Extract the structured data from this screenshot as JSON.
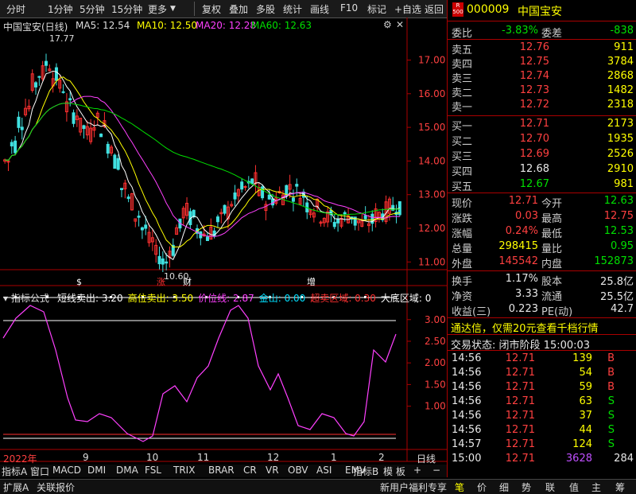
{
  "toolbar": {
    "left_items": [
      "分时",
      "1分钟",
      "5分钟",
      "15分钟",
      "更多"
    ],
    "right_items": [
      "复权",
      "叠加",
      "多股",
      "统计",
      "画线",
      "F10",
      "标记",
      "+自选",
      "返回"
    ]
  },
  "chart": {
    "title": "中国宝安(日线)",
    "ma5_label": "MA5: 12.54",
    "ma10_label": "MA10: 12.50",
    "ma20_label": "MA20: 12.28",
    "ma60_label": "MA60: 12.63",
    "high_label": "17.77",
    "low_label": "10.60",
    "price_ticks": [
      "17.00",
      "16.00",
      "15.00",
      "14.00",
      "13.00",
      "12.00",
      "11.00"
    ],
    "event_marks": [
      "$",
      "涨",
      "财",
      "增"
    ],
    "indicator_line": "指标公式",
    "ind_labels": [
      {
        "name": "短线卖出:",
        "value": "3.20",
        "color": "#ffffff"
      },
      {
        "name": "高位卖出:",
        "value": "3.50",
        "color": "#ffff00"
      },
      {
        "name": "价位线:",
        "value": "2.87",
        "color": "#ff40ff"
      },
      {
        "name": "金山:",
        "value": "0.00",
        "color": "#00e0ff"
      },
      {
        "name": "超卖区域:",
        "value": "0.30",
        "color": "#ff3030"
      },
      {
        "name": "大底区域:",
        "value": "0",
        "color": "#ffffff"
      }
    ],
    "ind_ticks": [
      "3.00",
      "2.50",
      "2.00",
      "1.50",
      "1.00"
    ],
    "date_labels": [
      "2022年",
      "9",
      "10",
      "11",
      "12",
      "1",
      "2"
    ],
    "period_label": "日线"
  },
  "indicator_tabs": [
    "指标A",
    "窗口",
    "MACD",
    "DMI",
    "DMA",
    "FSL",
    "TRIX",
    "BRAR",
    "CR",
    "VR",
    "OBV",
    "ASI",
    "EMV"
  ],
  "indicator_right": [
    "指标B",
    "模 板",
    "+",
    "−"
  ],
  "bottom_tabs_left": [
    "扩展A",
    "关联报价"
  ],
  "bottom_tabs_right": [
    "新用户福利专享",
    "笔",
    "价",
    "细",
    "势",
    "联",
    "值",
    "主",
    "筹"
  ],
  "quote": {
    "code": "000009",
    "name": "中国宝安",
    "r_badge": "R\n500",
    "weibi_label": "委比",
    "weibi": "-3.83%",
    "weicha_label": "委差",
    "weicha": "-838",
    "asks": [
      {
        "label": "卖五",
        "price": "12.76",
        "vol": "911"
      },
      {
        "label": "卖四",
        "price": "12.75",
        "vol": "3784"
      },
      {
        "label": "卖三",
        "price": "12.74",
        "vol": "2868"
      },
      {
        "label": "卖二",
        "price": "12.73",
        "vol": "1482"
      },
      {
        "label": "卖一",
        "price": "12.72",
        "vol": "2318"
      }
    ],
    "bids": [
      {
        "label": "买一",
        "price": "12.71",
        "vol": "2173",
        "color": "red"
      },
      {
        "label": "买二",
        "price": "12.70",
        "vol": "1935",
        "color": "red"
      },
      {
        "label": "买三",
        "price": "12.69",
        "vol": "2526",
        "color": "red"
      },
      {
        "label": "买四",
        "price": "12.68",
        "vol": "2910",
        "color": "white"
      },
      {
        "label": "买五",
        "price": "12.67",
        "vol": "981",
        "color": "green"
      }
    ],
    "stats": [
      {
        "l1": "现价",
        "v1": "12.71",
        "c1": "red",
        "l2": "今开",
        "v2": "12.63",
        "c2": "green"
      },
      {
        "l1": "涨跌",
        "v1": "0.03",
        "c1": "red",
        "l2": "最高",
        "v2": "12.75",
        "c2": "red"
      },
      {
        "l1": "涨幅",
        "v1": "0.24%",
        "c1": "red",
        "l2": "最低",
        "v2": "12.53",
        "c2": "green"
      },
      {
        "l1": "总量",
        "v1": "298415",
        "c1": "yellow",
        "l2": "量比",
        "v2": "0.95",
        "c2": "green"
      },
      {
        "l1": "外盘",
        "v1": "145542",
        "c1": "red",
        "l2": "内盘",
        "v2": "152873",
        "c2": "green"
      }
    ],
    "fund": [
      {
        "l1": "换手",
        "v1": "1.17%",
        "l2": "股本",
        "v2": "25.8亿"
      },
      {
        "l1": "净资",
        "v1": "3.33",
        "l2": "流通",
        "v2": "25.5亿"
      },
      {
        "l1": "收益(三)",
        "v1": "0.223",
        "l2": "PE(动)",
        "v2": "42.7"
      }
    ],
    "promo": "通达信，仅需20元查看千档行情",
    "status_label": "交易状态:",
    "status_value": "闭市阶段",
    "status_time": "15:00:03",
    "ticks": [
      {
        "time": "14:56",
        "price": "12.71",
        "vol": "139",
        "side": "B"
      },
      {
        "time": "14:56",
        "price": "12.71",
        "vol": "54",
        "side": "B"
      },
      {
        "time": "14:56",
        "price": "12.71",
        "vol": "59",
        "side": "B"
      },
      {
        "time": "14:56",
        "price": "12.71",
        "vol": "63",
        "side": "S"
      },
      {
        "time": "14:56",
        "price": "12.71",
        "vol": "37",
        "side": "S"
      },
      {
        "time": "14:56",
        "price": "12.71",
        "vol": "44",
        "side": "S"
      },
      {
        "time": "14:57",
        "price": "12.71",
        "vol": "124",
        "side": "S"
      },
      {
        "time": "15:00",
        "price": "12.71",
        "vol": "3628",
        "side": "284"
      }
    ]
  }
}
